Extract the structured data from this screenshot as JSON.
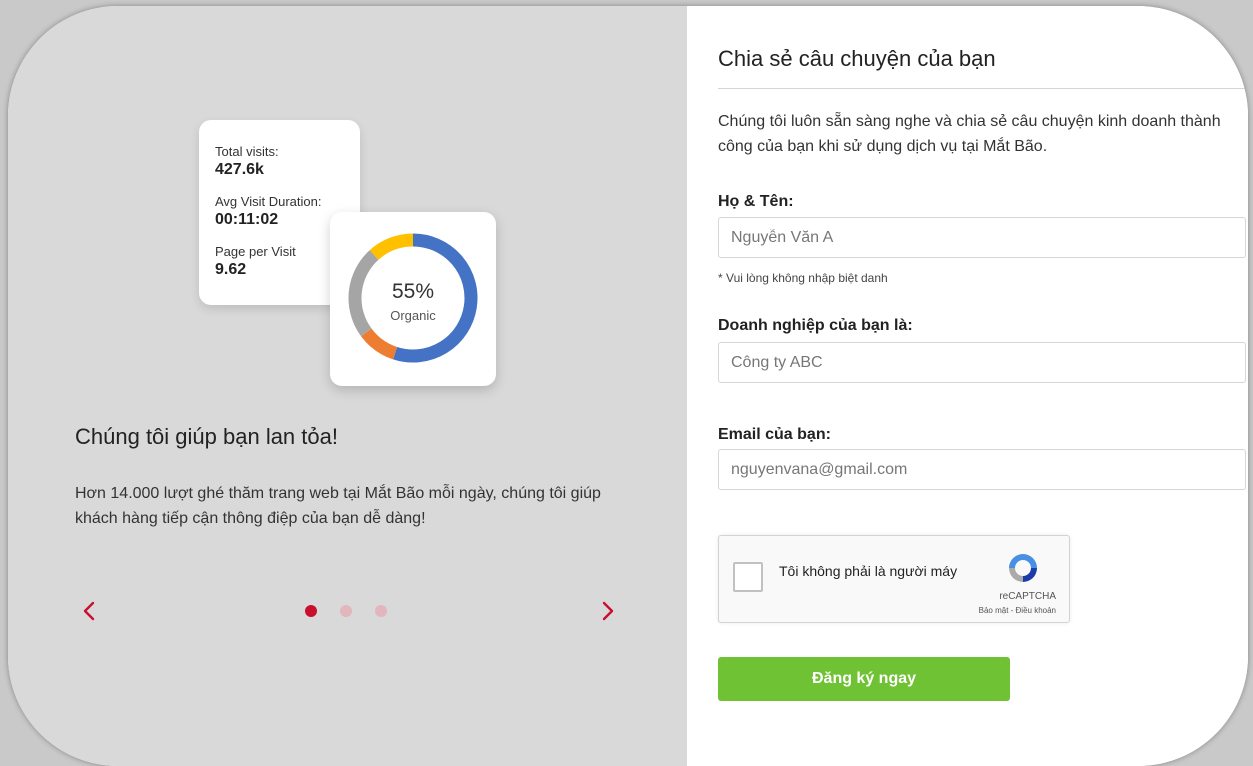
{
  "showcase": {
    "stats": [
      {
        "label": "Total visits:",
        "value": "427.6k"
      },
      {
        "label": "Avg Visit Duration:",
        "value": "00:11:02"
      },
      {
        "label": "Page per Visit",
        "value": "9.62"
      }
    ],
    "donut": {
      "percent_label": "55%",
      "caption": "Organic",
      "organic_fraction": 0.55
    },
    "title": "Chúng tôi giúp bạn lan tỏa!",
    "description": "Hơn 14.000 lượt ghé thăm trang web tại Mắt Bão mỗi ngày, chúng tôi giúp khách hàng tiếp cận thông điệp của bạn dễ dàng!",
    "carousel": {
      "active_index": 0,
      "dot_count": 3
    }
  },
  "form": {
    "title": "Chia sẻ câu chuyện của bạn",
    "intro": "Chúng tôi luôn sẵn sàng nghe và chia sẻ câu chuyện kinh doanh thành công của bạn khi sử dụng dịch vụ tại Mắt Bão.",
    "name_label": "Họ & Tên:",
    "name_placeholder": "Nguyễn Văn A",
    "name_hint": "* Vui lòng không nhập biệt danh",
    "company_label": "Doanh nghiệp của bạn là:",
    "company_placeholder": "Công ty ABC",
    "email_label": "Email của bạn:",
    "email_placeholder": "nguyenvana@gmail.com",
    "captcha": {
      "text": "Tôi không phải là người máy",
      "brand": "reCAPTCHA",
      "links": "Bảo mật - Điều khoản"
    },
    "submit_label": "Đăng ký ngay"
  },
  "colors": {
    "accent_red": "#c8102e",
    "submit_green": "#6fc234",
    "donut_blue": "#4472c4",
    "donut_orange": "#ed7d31",
    "donut_gray": "#a5a5a5",
    "donut_yellow": "#ffc000",
    "dot_inactive": "#e3b5bd"
  }
}
